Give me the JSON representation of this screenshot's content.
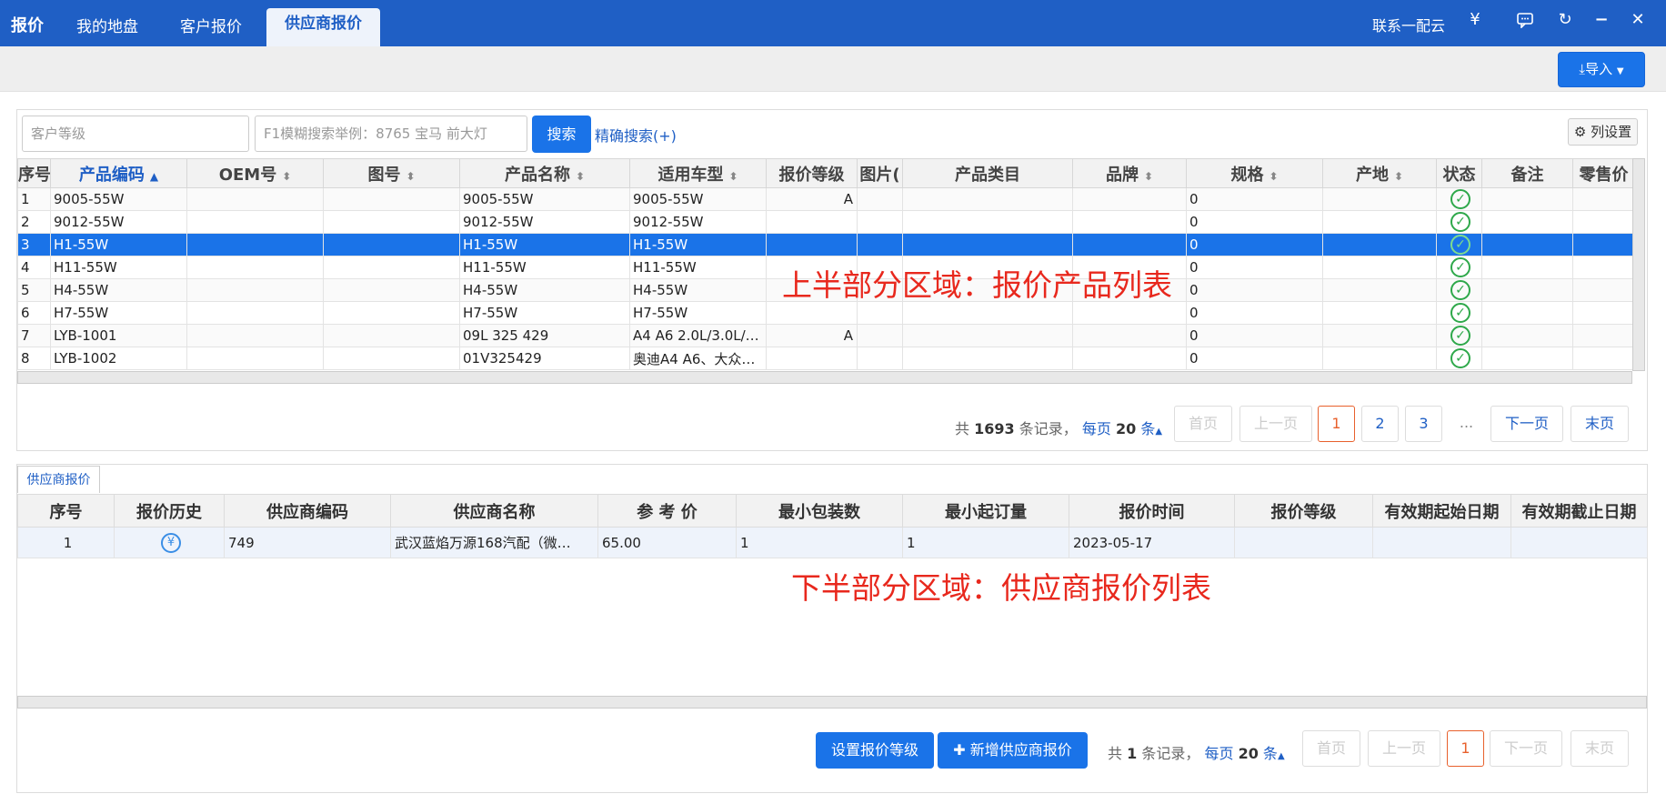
{
  "topbar": {
    "brand": "报价",
    "tabs": [
      "我的地盘",
      "客户报价"
    ],
    "active_tab": "供应商报价",
    "contact": "联系一配云",
    "icons": {
      "yen": "¥",
      "chat": "💬",
      "refresh": "↻",
      "minimize": "−",
      "close": "✕"
    }
  },
  "toolbar": {
    "import_label": "导入"
  },
  "search": {
    "level_placeholder": "客户等级",
    "keyword_placeholder": "F1模糊搜索举例：8765 宝马 前大灯",
    "search_button": "搜索",
    "precise_search": "精确搜索(+)",
    "column_settings": "列设置"
  },
  "product_table": {
    "columns": [
      "序号",
      "产品编码",
      "OEM号",
      "图号",
      "产品名称",
      "适用车型",
      "报价等级",
      "图片(",
      "产品类目",
      "品牌",
      "规格",
      "产地",
      "状态",
      "备注",
      "零售价"
    ],
    "rows": [
      [
        "1",
        "9005-55W",
        "",
        "",
        "9005-55W",
        "9005-55W",
        "A",
        "",
        "",
        "",
        "0",
        "",
        "ok",
        "",
        ""
      ],
      [
        "2",
        "9012-55W",
        "",
        "",
        "9012-55W",
        "9012-55W",
        "",
        "",
        "",
        "",
        "0",
        "",
        "ok",
        "",
        ""
      ],
      [
        "3",
        "H1-55W",
        "",
        "",
        "H1-55W",
        "H1-55W",
        "",
        "",
        "",
        "",
        "0",
        "",
        "ok",
        "",
        ""
      ],
      [
        "4",
        "H11-55W",
        "",
        "",
        "H11-55W",
        "H11-55W",
        "",
        "",
        "",
        "",
        "0",
        "",
        "ok",
        "",
        ""
      ],
      [
        "5",
        "H4-55W",
        "",
        "",
        "H4-55W",
        "H4-55W",
        "",
        "",
        "",
        "",
        "0",
        "",
        "ok",
        "",
        ""
      ],
      [
        "6",
        "H7-55W",
        "",
        "",
        "H7-55W",
        "H7-55W",
        "",
        "",
        "",
        "",
        "0",
        "",
        "ok",
        "",
        ""
      ],
      [
        "7",
        "LYB-1001",
        "",
        "",
        "09L 325 429",
        "A4 A6 2.0L/3.0L/…",
        "A",
        "",
        "",
        "",
        "0",
        "",
        "ok",
        "",
        ""
      ],
      [
        "8",
        "LYB-1002",
        "",
        "",
        "01V325429",
        "奥迪A4 A6、大众…",
        "",
        "",
        "",
        "",
        "0",
        "",
        "ok",
        "",
        ""
      ]
    ],
    "selected_row": 3
  },
  "annotations": {
    "upper": "上半部分区域：报价产品列表",
    "lower": "下半部分区域：供应商报价列表"
  },
  "pager1": {
    "total_prefix": "共",
    "total": "1693",
    "total_suffix": "条记录，",
    "per_page_prefix": "每页",
    "per_page": "20",
    "per_page_suffix": "条",
    "first": "首页",
    "prev": "上一页",
    "pages": [
      "1",
      "2",
      "3"
    ],
    "ellipsis": "...",
    "next": "下一页",
    "last": "末页"
  },
  "supplier_tab": "供应商报价",
  "supplier_table": {
    "columns": [
      "序号",
      "报价历史",
      "供应商编码",
      "供应商名称",
      "参 考 价",
      "最小包装数",
      "最小起订量",
      "报价时间",
      "报价等级",
      "有效期起始日期",
      "有效期截止日期"
    ],
    "rows": [
      [
        "1",
        "¥",
        "749",
        "武汉蓝焰万源168汽配（微…",
        "65.00",
        "1",
        "1",
        "2023-05-17",
        "",
        "",
        ""
      ]
    ]
  },
  "bottom_actions": {
    "set_level": "设置报价等级",
    "add_quote": "新增供应商报价"
  },
  "pager2": {
    "total_prefix": "共",
    "total": "1",
    "total_suffix": "条记录，",
    "per_page_prefix": "每页",
    "per_page": "20",
    "per_page_suffix": "条",
    "first": "首页",
    "prev": "上一页",
    "page": "1",
    "next": "下一页",
    "last": "末页"
  }
}
